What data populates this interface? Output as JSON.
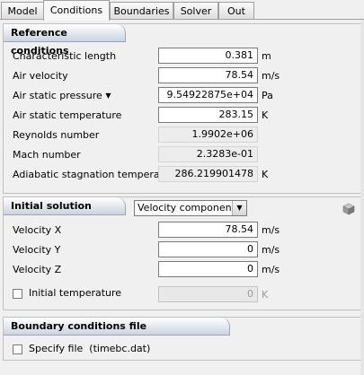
{
  "tabs": [
    "Model",
    "Conditions",
    "Boundaries",
    "Solver",
    "Out"
  ],
  "active_tab": "Conditions",
  "reference": {
    "title": "Reference conditions",
    "rows": [
      {
        "label": "Characteristic length",
        "value": "0.381",
        "unit": "m"
      },
      {
        "label": "Air velocity",
        "value": "78.54",
        "unit": "m/s"
      },
      {
        "label": "Air static pressure",
        "value": "9.54922875e+04",
        "unit": "Pa"
      },
      {
        "label": "Air static temperature",
        "value": "283.15",
        "unit": "K"
      },
      {
        "label": "Reynolds number",
        "value": "1.9902e+06",
        "unit": ""
      },
      {
        "label": "Mach number",
        "value": "2.3283e-01",
        "unit": ""
      },
      {
        "label": "Adiabatic stagnation temperature",
        "value": "286.219901478",
        "unit": "K"
      }
    ]
  },
  "initial": {
    "title": "Initial solution",
    "mode": "Velocity components",
    "rows": [
      {
        "label": "Velocity X",
        "value": "78.54",
        "unit": "m/s"
      },
      {
        "label": "Velocity Y",
        "value": "0",
        "unit": "m/s"
      },
      {
        "label": "Velocity Z",
        "value": "0",
        "unit": "m/s"
      }
    ],
    "temperature": {
      "label": "Initial temperature",
      "value": "0",
      "unit": "K",
      "checked": false
    }
  },
  "boundary": {
    "title": "Boundary conditions file",
    "specify_label": "Specify file",
    "file_hint": "(timebc.dat)",
    "checked": false
  }
}
